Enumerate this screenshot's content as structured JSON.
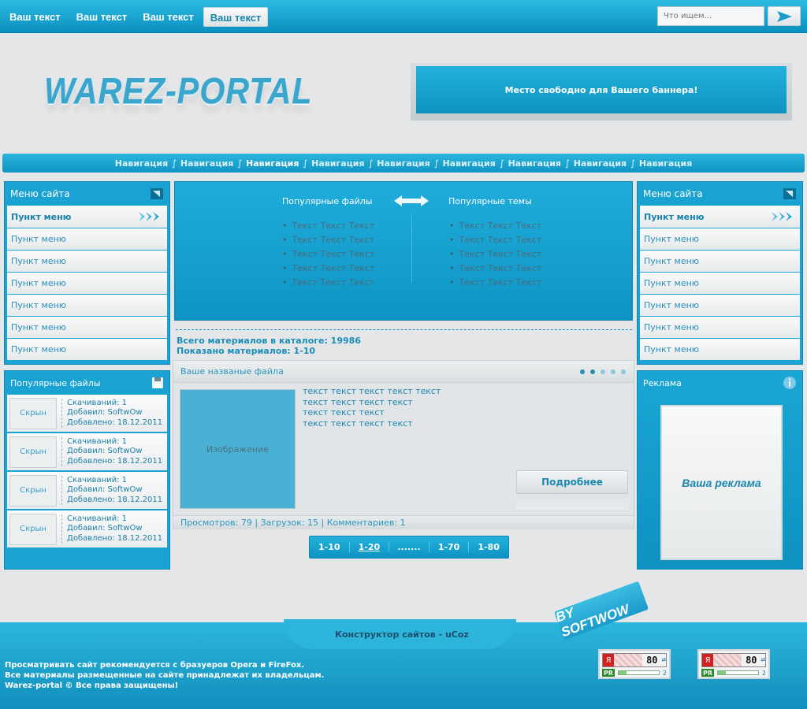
{
  "topnav": {
    "items": [
      {
        "label": "Ваш текст"
      },
      {
        "label": "Ваш текст"
      },
      {
        "label": "Ваш текст"
      },
      {
        "label": "Ваш текст"
      }
    ]
  },
  "search": {
    "placeholder": "Что ищем..."
  },
  "header": {
    "logo": "WAREZ-PORTAL",
    "banner_text": "Место свободно для Вашего баннера!"
  },
  "nav": {
    "items": [
      "Навигация",
      "Навигация",
      "Навигация",
      "Навигация",
      "Навигация",
      "Навигация",
      "Навигация",
      "Навигация",
      "Навигация"
    ],
    "separator": "∫"
  },
  "left_menu": {
    "title": "Меню сайта",
    "items": [
      "Пункт меню",
      "Пункт меню",
      "Пункт меню",
      "Пункт меню",
      "Пункт меню",
      "Пункт меню",
      "Пункт меню"
    ]
  },
  "right_menu": {
    "title": "Меню сайта",
    "items": [
      "Пункт меню",
      "Пункт меню",
      "Пункт меню",
      "Пункт меню",
      "Пункт меню",
      "Пункт меню",
      "Пункт меню"
    ]
  },
  "popular_files": {
    "title": "Популярные файлы",
    "items": [
      {
        "thumb": "Скрын",
        "downloads": "Скачиваний: 1",
        "added_by": "Добавил: SoftwOw",
        "added_on": "Добавлено: 18.12.2011"
      },
      {
        "thumb": "Скрын",
        "downloads": "Скачиваний: 1",
        "added_by": "Добавил: SoftwOw",
        "added_on": "Добавлено: 18.12.2011"
      },
      {
        "thumb": "Скрын",
        "downloads": "Скачиваний: 1",
        "added_by": "Добавил: SoftwOw",
        "added_on": "Добавлено: 18.12.2011"
      },
      {
        "thumb": "Скрын",
        "downloads": "Скачиваний: 1",
        "added_by": "Добавил: SoftwOw",
        "added_on": "Добавлено: 18.12.2011"
      }
    ]
  },
  "popular_block": {
    "left_title": "Популярные файлы",
    "right_title": "Популярные темы",
    "left_items": [
      "Текст Текст Текст",
      "Текст Текст Текст",
      "Текст Текст Текст",
      "Текст Текст Текст",
      "Текст Текст Текст"
    ],
    "right_items": [
      "Текст Текст Текст",
      "Текст Текст Текст",
      "Текст Текст Текст",
      "Текст Текст Текст",
      "Текст Текст Текст"
    ]
  },
  "stats": {
    "total": "Всего материалов в каталоге: 19986",
    "shown": "Показано материалов: 1-10"
  },
  "entry": {
    "title": "Ваше названые файла",
    "image_label": "Изображение",
    "text_lines": [
      "текст текст текст текст текст",
      "текст текст текст текст",
      "текст текст текст",
      "текст текст текст текст"
    ],
    "more_label": "Подробнее",
    "footer": "Просмотров: 79 | Загрузок: 15 | Комментариев: 1"
  },
  "pager": {
    "pages": [
      "1-10",
      "1-20",
      ".......",
      "1-70",
      "1-80"
    ]
  },
  "ad": {
    "title": "Реклама",
    "card_text": "Ваша реклама"
  },
  "footer": {
    "constructor": "Конструктор сайтов - uCoz",
    "tag": "BY SOFTWOW",
    "lines": [
      "Просматривать сайт рекомендуется с бразуеров Opera и FireFox.",
      "Все материалы размещенные на сайте принадлежат их владельцам.",
      "Warez-portal © Все права защищены!"
    ],
    "counter": {
      "ya": "Я",
      "value": "80",
      "pr": "PR",
      "pr_value": "2"
    }
  },
  "colors": {
    "primary": "#1aa3d2",
    "primary_dark": "#0e93c2",
    "text_blue": "#1c86ad",
    "page_bg": "#e4e6e8"
  }
}
